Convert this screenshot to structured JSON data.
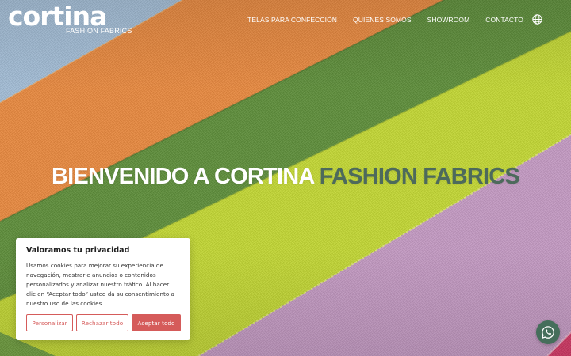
{
  "brand": {
    "logo_text": "cortina",
    "logo_subtitle": "FASHION FABRICS"
  },
  "nav": {
    "items": [
      {
        "label": "TELAS PARA CONFECCIÓN"
      },
      {
        "label": "QUIENES SOMOS"
      },
      {
        "label": "SHOWROOM"
      },
      {
        "label": "CONTACTO"
      }
    ],
    "language_icon": "globe-icon"
  },
  "hero": {
    "title_main": "BIENVENIDO A CORTINA",
    "title_accent": "FASHION FABRICS"
  },
  "cookie_banner": {
    "title": "Valoramos tu privacidad",
    "text": "Usamos cookies para mejorar su experiencia de navegación, mostrarle anuncios o contenidos personalizados y analizar nuestro tráfico. Al hacer clic en “Aceptar todo” usted da su consentimiento a nuestro uso de las cookies.",
    "buttons": {
      "customize": "Personalizar",
      "reject": "Rechazar todo",
      "accept": "Aceptar todo"
    }
  },
  "floating": {
    "whatsapp_icon": "whatsapp-icon"
  },
  "colors": {
    "accent_text": "#4d6a5c",
    "cookie_button": "#d55b5a",
    "whatsapp_bg": "#456e5b",
    "fabric_blue": "#9ab6d2",
    "fabric_orange": "#e88a45",
    "fabric_green": "#5f8f3b",
    "fabric_lime": "#c6d935",
    "fabric_pink": "#c69bc4",
    "fabric_magenta": "#d63867"
  }
}
